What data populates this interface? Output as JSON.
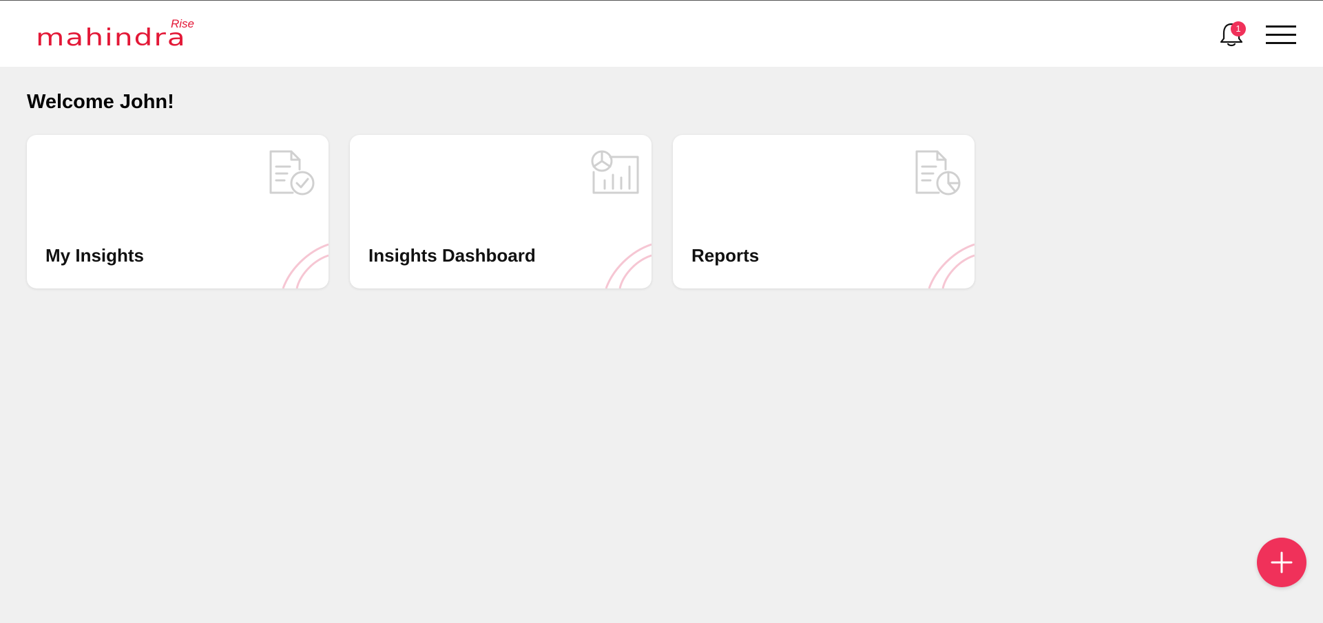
{
  "header": {
    "logo_main": "mahindra",
    "logo_sub": "Rise",
    "notification_count": "1"
  },
  "main": {
    "welcome": "Welcome John!",
    "cards": [
      {
        "label": "My Insights",
        "icon": "document-check-icon"
      },
      {
        "label": "Insights Dashboard",
        "icon": "dashboard-chart-icon"
      },
      {
        "label": "Reports",
        "icon": "document-pie-chart-icon"
      }
    ]
  },
  "colors": {
    "brand": "#e31837",
    "accent": "#f0315a",
    "background": "#f0f0f0",
    "icon_gray": "#d0d0d0"
  }
}
